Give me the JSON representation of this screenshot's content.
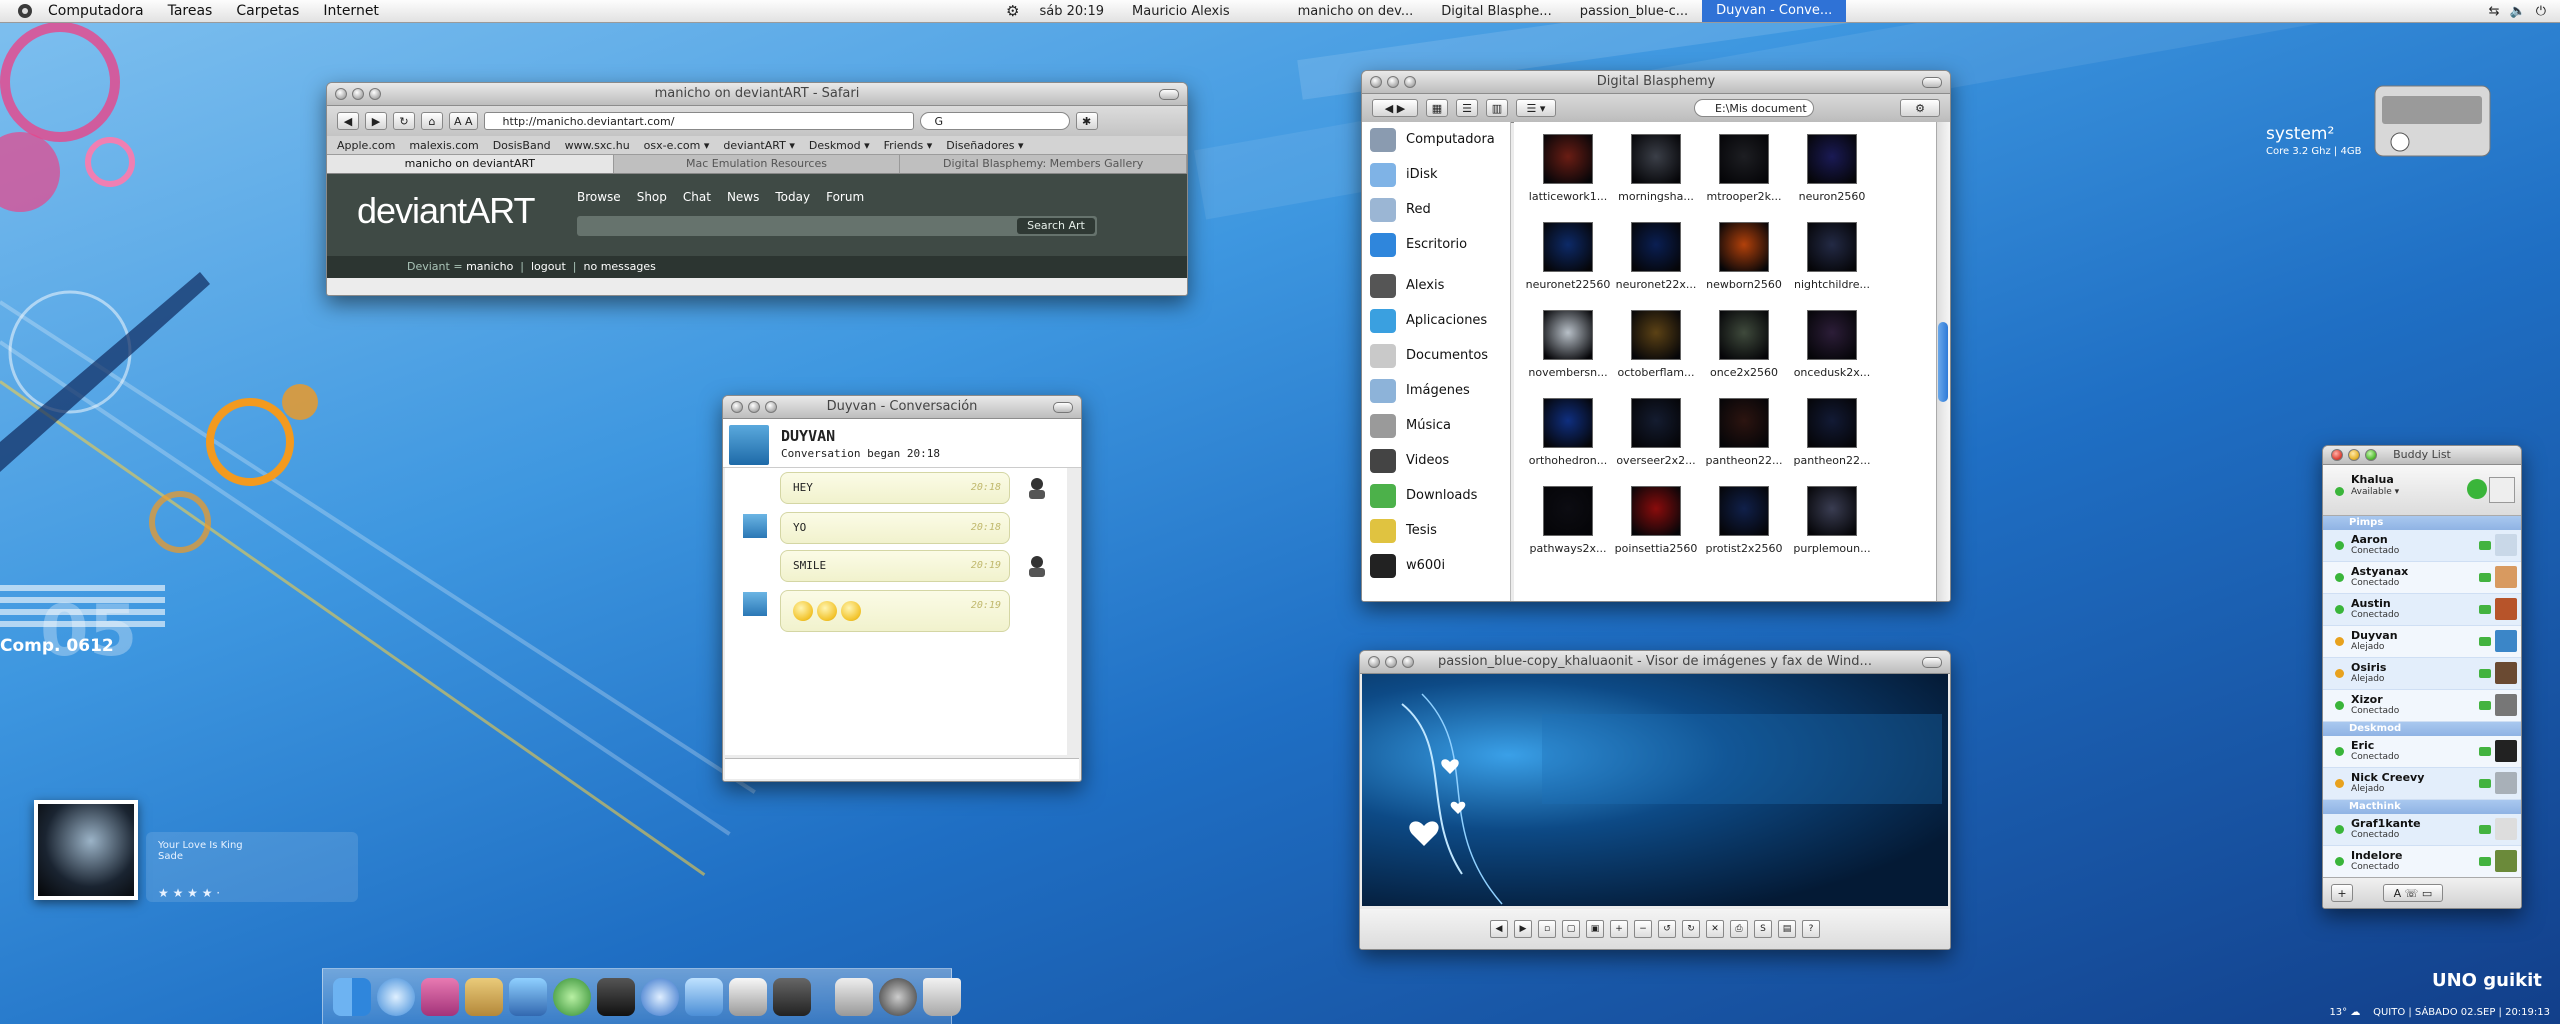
{
  "menubar": {
    "items": [
      "Computadora",
      "Tareas",
      "Carpetas",
      "Internet"
    ],
    "clock": "sáb 20:19",
    "user": "Mauricio Alexis",
    "tasks": [
      "manicho on dev...",
      "Digital Blasphe...",
      "passion_blue-c...",
      "Duyvan - Conve..."
    ]
  },
  "safari": {
    "title": "manicho on deviantART - Safari",
    "url": "http://manicho.deviantart.com/",
    "search_value": "G",
    "bookmarks": [
      "Apple.com",
      "malexis.com",
      "DosisBand",
      "www.sxc.hu",
      "osx-e.com ▾",
      "deviantART ▾",
      "Deskmod ▾",
      "Friends ▾",
      "Diseñadores ▾"
    ],
    "tabs": [
      "manicho on deviantART",
      "Mac Emulation Resources",
      "Digital Blasphemy: Members Gallery"
    ],
    "logo": "deviantART",
    "nav": [
      "Browse",
      "Shop",
      "Chat",
      "News",
      "Today",
      "Forum"
    ],
    "search_button": "Search Art",
    "bar_label": "Deviant",
    "bar_user": "manicho",
    "bar_logout": "logout",
    "bar_messages": "no messages"
  },
  "finder": {
    "title": "Digital Blasphemy",
    "search_value": "E:\\Mis document",
    "sidebar": [
      "Computadora",
      "iDisk",
      "Red",
      "Escritorio",
      "Alexis",
      "Aplicaciones",
      "Documentos",
      "Imágenes",
      "Música",
      "Videos",
      "Downloads",
      "Tesis",
      "w600i"
    ],
    "files": [
      {
        "name": "latticework1...",
        "color": "#6a1d14"
      },
      {
        "name": "morningsha...",
        "color": "#3b3f48"
      },
      {
        "name": "mtrooper2k...",
        "color": "#1d1e22"
      },
      {
        "name": "neuron2560",
        "color": "#1a1a55"
      },
      {
        "name": "neuronet22560",
        "color": "#0d2a68"
      },
      {
        "name": "neuronet22x...",
        "color": "#0a1f53"
      },
      {
        "name": "newborn2560",
        "color": "#b2410b"
      },
      {
        "name": "nightchildre...",
        "color": "#232a45"
      },
      {
        "name": "novembersn...",
        "color": "#b8c0c8"
      },
      {
        "name": "octoberflam...",
        "color": "#5c4215"
      },
      {
        "name": "once2x2560",
        "color": "#3f4a3c"
      },
      {
        "name": "oncedusk2x...",
        "color": "#2c1d38"
      },
      {
        "name": "orthohedron...",
        "color": "#0f2f80"
      },
      {
        "name": "overseer2x2...",
        "color": "#141c30"
      },
      {
        "name": "pantheon22...",
        "color": "#2c1410"
      },
      {
        "name": "pantheon22...",
        "color": "#121a35"
      },
      {
        "name": "pathways2x...",
        "color": "#0c0c12"
      },
      {
        "name": "poinsettia2560",
        "color": "#8a0c0c"
      },
      {
        "name": "protist2x2560",
        "color": "#10204a"
      },
      {
        "name": "purplemoun...",
        "color": "#3a3d52"
      }
    ]
  },
  "chat": {
    "title": "Duyvan - Conversación",
    "name": "DUYVAN",
    "subtitle": "Conversation began 20:18",
    "messages": [
      {
        "text": "HEY",
        "time": "20:18",
        "from": "them"
      },
      {
        "text": "YO",
        "time": "20:18",
        "from": "me"
      },
      {
        "text": "SMILE",
        "time": "20:19",
        "from": "them"
      },
      {
        "text": "",
        "time": "20:19",
        "from": "me"
      }
    ]
  },
  "viewer": {
    "title": "passion_blue-copy_khaluaonit - Visor de imágenes y fax de Wind..."
  },
  "buddy": {
    "title": "Buddy List",
    "me_name": "Khalua",
    "me_status": "Available ▾",
    "groups": [
      {
        "name": "Pimps",
        "buddies": [
          {
            "name": "Aaron",
            "status": "Conectado",
            "dot": "#3ab53a"
          },
          {
            "name": "Astyanax",
            "status": "Conectado",
            "dot": "#3ab53a"
          },
          {
            "name": "Austin",
            "status": "Conectado",
            "dot": "#3ab53a"
          },
          {
            "name": "Duyvan",
            "status": "Alejado",
            "dot": "#e8a21e"
          },
          {
            "name": "Osiris",
            "status": "Alejado",
            "dot": "#e8a21e"
          },
          {
            "name": "Xizor",
            "status": "Conectado",
            "dot": "#3ab53a"
          }
        ]
      },
      {
        "name": "Deskmod",
        "buddies": [
          {
            "name": "Eric",
            "status": "Conectado",
            "dot": "#3ab53a"
          },
          {
            "name": "Nick Creevy",
            "status": "Alejado",
            "dot": "#e8a21e"
          }
        ]
      },
      {
        "name": "Macthink",
        "buddies": [
          {
            "name": "Graf1kante",
            "status": "Conectado",
            "dot": "#3ab53a"
          },
          {
            "name": "Indelore",
            "status": "Conectado",
            "dot": "#3ab53a"
          }
        ]
      }
    ]
  },
  "itunes": {
    "song": "Your Love Is King",
    "artist": "Sade",
    "stars": "★ ★ ★ ★ ·"
  },
  "desktop": {
    "comp_label": "Comp. 0612",
    "comp_number": "05",
    "system_name": "system²",
    "system_spec": "Core 3.2 Ghz | 4GB",
    "brand": "UNO guikit",
    "weather_temp": "13°",
    "status_line": "QUITO  |  SÁBADO 02.SEP  |  20:19:13"
  }
}
